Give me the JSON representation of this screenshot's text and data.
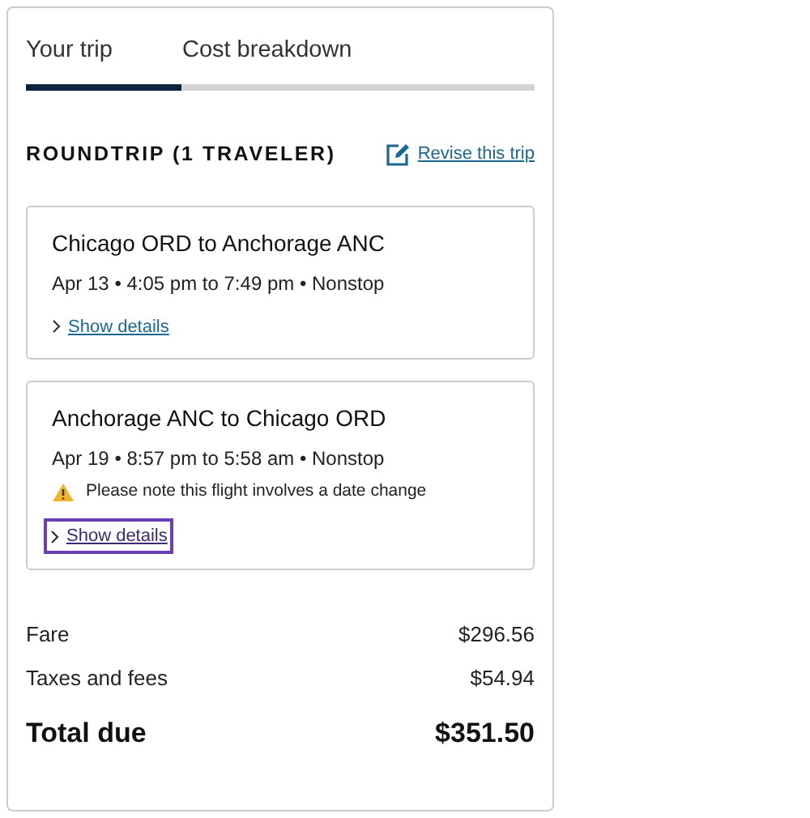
{
  "tabs": [
    {
      "label": "Your trip",
      "selected": true
    },
    {
      "label": "Cost breakdown",
      "selected": false
    }
  ],
  "trip": {
    "heading": "ROUNDTRIP (1 TRAVELER)",
    "revise_link": "Revise this trip"
  },
  "flights": [
    {
      "route": "Chicago ORD to Anchorage ANC",
      "schedule": "Apr 13 • 4:05 pm to 7:49 pm • Nonstop",
      "details_link": "Show details",
      "focused": false
    },
    {
      "route": "Anchorage ANC to Chicago ORD",
      "schedule": "Apr 19 • 8:57 pm to 5:58 am • Nonstop",
      "warning": "Please note this flight involves a date change",
      "details_link": "Show details",
      "focused": true
    }
  ],
  "costs": [
    {
      "label": "Fare",
      "amount": "$296.56"
    },
    {
      "label": "Taxes and fees",
      "amount": "$54.94"
    }
  ],
  "total": {
    "label": "Total due",
    "amount": "$351.50"
  }
}
